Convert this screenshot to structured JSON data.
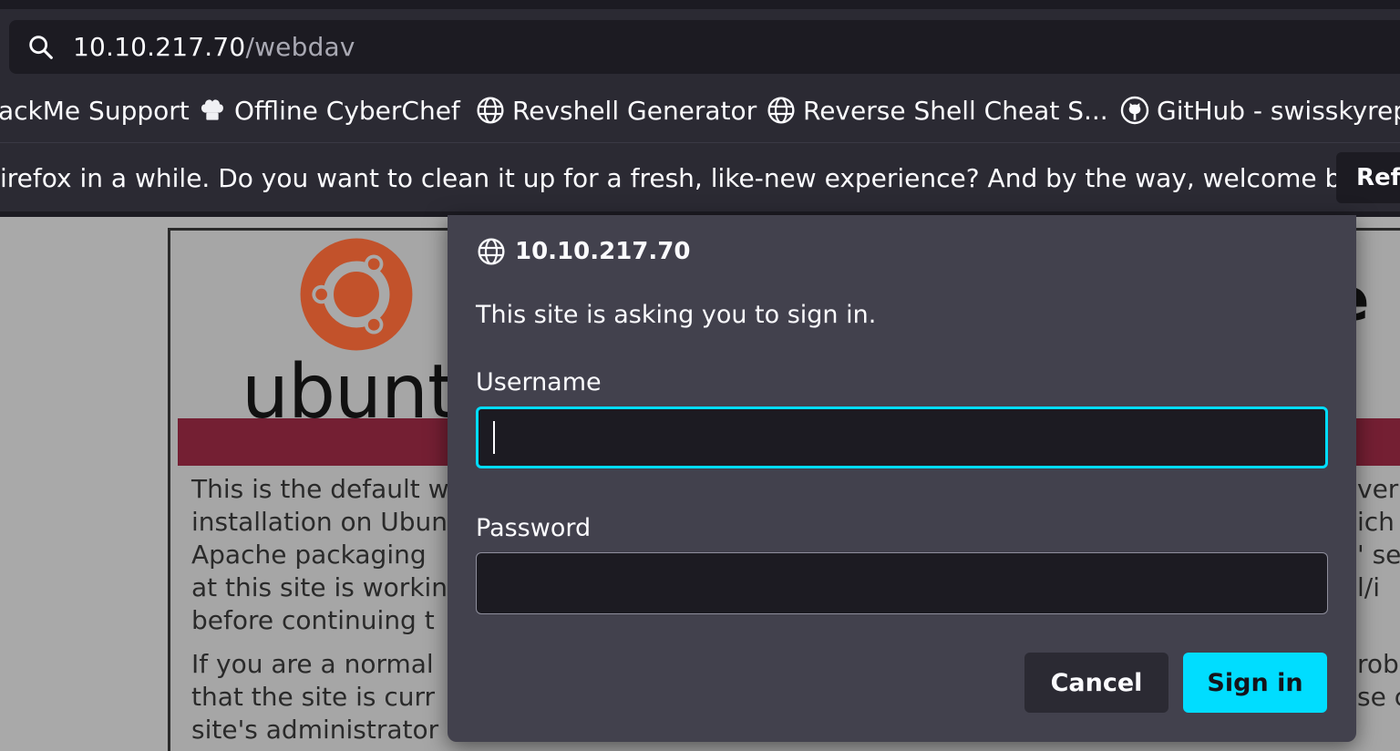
{
  "urlbar": {
    "host": "10.10.217.70",
    "path": "/webdav"
  },
  "bookmarks": [
    {
      "label": "ackMe Support",
      "icon": "none"
    },
    {
      "label": "Offline CyberChef",
      "icon": "chef-hat-icon"
    },
    {
      "label": "Revshell Generator",
      "icon": "globe-icon"
    },
    {
      "label": "Reverse Shell Cheat S...",
      "icon": "globe-icon"
    },
    {
      "label": "GitHub - swisskyrepo",
      "icon": "github-icon"
    }
  ],
  "notification": {
    "message": "irefox in a while. Do you want to clean it up for a fresh, like-new experience? And by the way, welcome back!",
    "button_label": "Refresh"
  },
  "background_page": {
    "logo_word": "ubuntu",
    "edge_letter": "e",
    "left_lines": [
      "This is the default w",
      "installation on Ubun",
      "Apache packaging",
      "at this site is workin",
      "before continuing t"
    ],
    "left_lines_2": [
      "If you are a normal",
      "that the site is curr",
      "site's administrator"
    ],
    "right_lines": [
      "ver",
      "ich",
      "' se",
      "l/i"
    ],
    "right_lines_2": [
      "roba",
      "se c"
    ]
  },
  "dialog": {
    "host": "10.10.217.70",
    "prompt": "This site is asking you to sign in.",
    "username_label": "Username",
    "username_value": "",
    "password_label": "Password",
    "password_value": "",
    "cancel_label": "Cancel",
    "signin_label": "Sign in"
  },
  "colors": {
    "accent": "#00ddff",
    "dialog_bg": "#42414d",
    "toolbar_bg": "#2b2a33",
    "banner": "#741f33",
    "ubuntu_orange": "#c2522b"
  }
}
